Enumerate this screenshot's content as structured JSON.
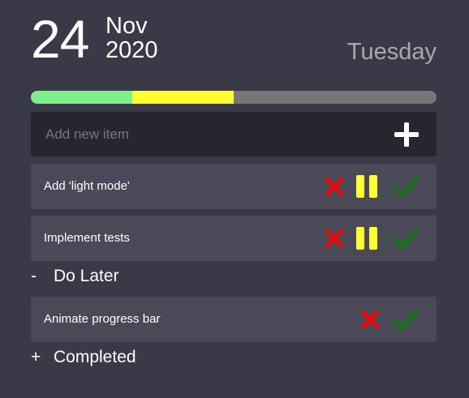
{
  "header": {
    "day": "24",
    "month": "Nov",
    "year": "2020",
    "weekday": "Tuesday"
  },
  "progress": {
    "done_fraction": 0.25,
    "paused_fraction": 0.25,
    "colors": {
      "done": "#7ef08a",
      "paused": "#ffff33",
      "remaining": "#777777"
    }
  },
  "add_item": {
    "placeholder": "Add new item",
    "button_icon": "plus-icon"
  },
  "todo_items": [
    {
      "label": "Add 'light mode'",
      "actions": [
        "delete-icon",
        "pause-icon",
        "check-icon"
      ]
    },
    {
      "label": "Implement tests",
      "actions": [
        "delete-icon",
        "pause-icon",
        "check-icon"
      ]
    }
  ],
  "sections": {
    "do_later": {
      "sign": "-",
      "title": "Do Later",
      "items": [
        {
          "label": "Animate progress bar",
          "actions": [
            "delete-icon",
            "check-icon"
          ]
        }
      ]
    },
    "completed": {
      "sign": "+",
      "title": "Completed"
    }
  },
  "colors": {
    "background": "#3a3947",
    "item_background": "#4a4957",
    "input_background": "#27262e",
    "delete": "#ff0000",
    "pause": "#ffff33",
    "check": "#0f7a0f"
  }
}
